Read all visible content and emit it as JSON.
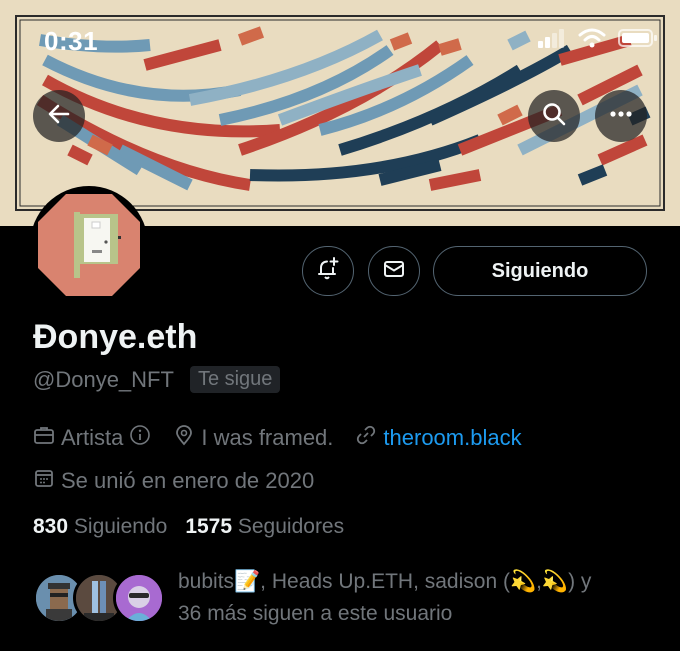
{
  "status_bar": {
    "time": "0:31"
  },
  "header": {
    "back_icon": "arrow-left-icon",
    "search_icon": "search-icon",
    "more_icon": "more-dots-icon"
  },
  "profile": {
    "display_name": "Đonye.eth",
    "handle": "@Donye_NFT",
    "follows_you_badge": "Te sigue",
    "category": "Artista",
    "location": "I was framed.",
    "website": "theroom.black",
    "joined": "Se unió en enero de 2020",
    "following_count": "830",
    "following_label": "Siguiendo",
    "followers_count": "1575",
    "followers_label": "Seguidores"
  },
  "actions": {
    "notify_icon": "bell-plus-icon",
    "message_icon": "envelope-icon",
    "follow_button_label": "Siguiendo"
  },
  "known_followers": {
    "line1": "bubits📝, Heads Up.ETH, sadison (💫,💫) y",
    "line2": "36 más siguen a este usuario"
  },
  "colors": {
    "accent_link": "#1d9bf0",
    "banner_bg": "#e9dcc0",
    "text_secondary": "#71767b"
  }
}
